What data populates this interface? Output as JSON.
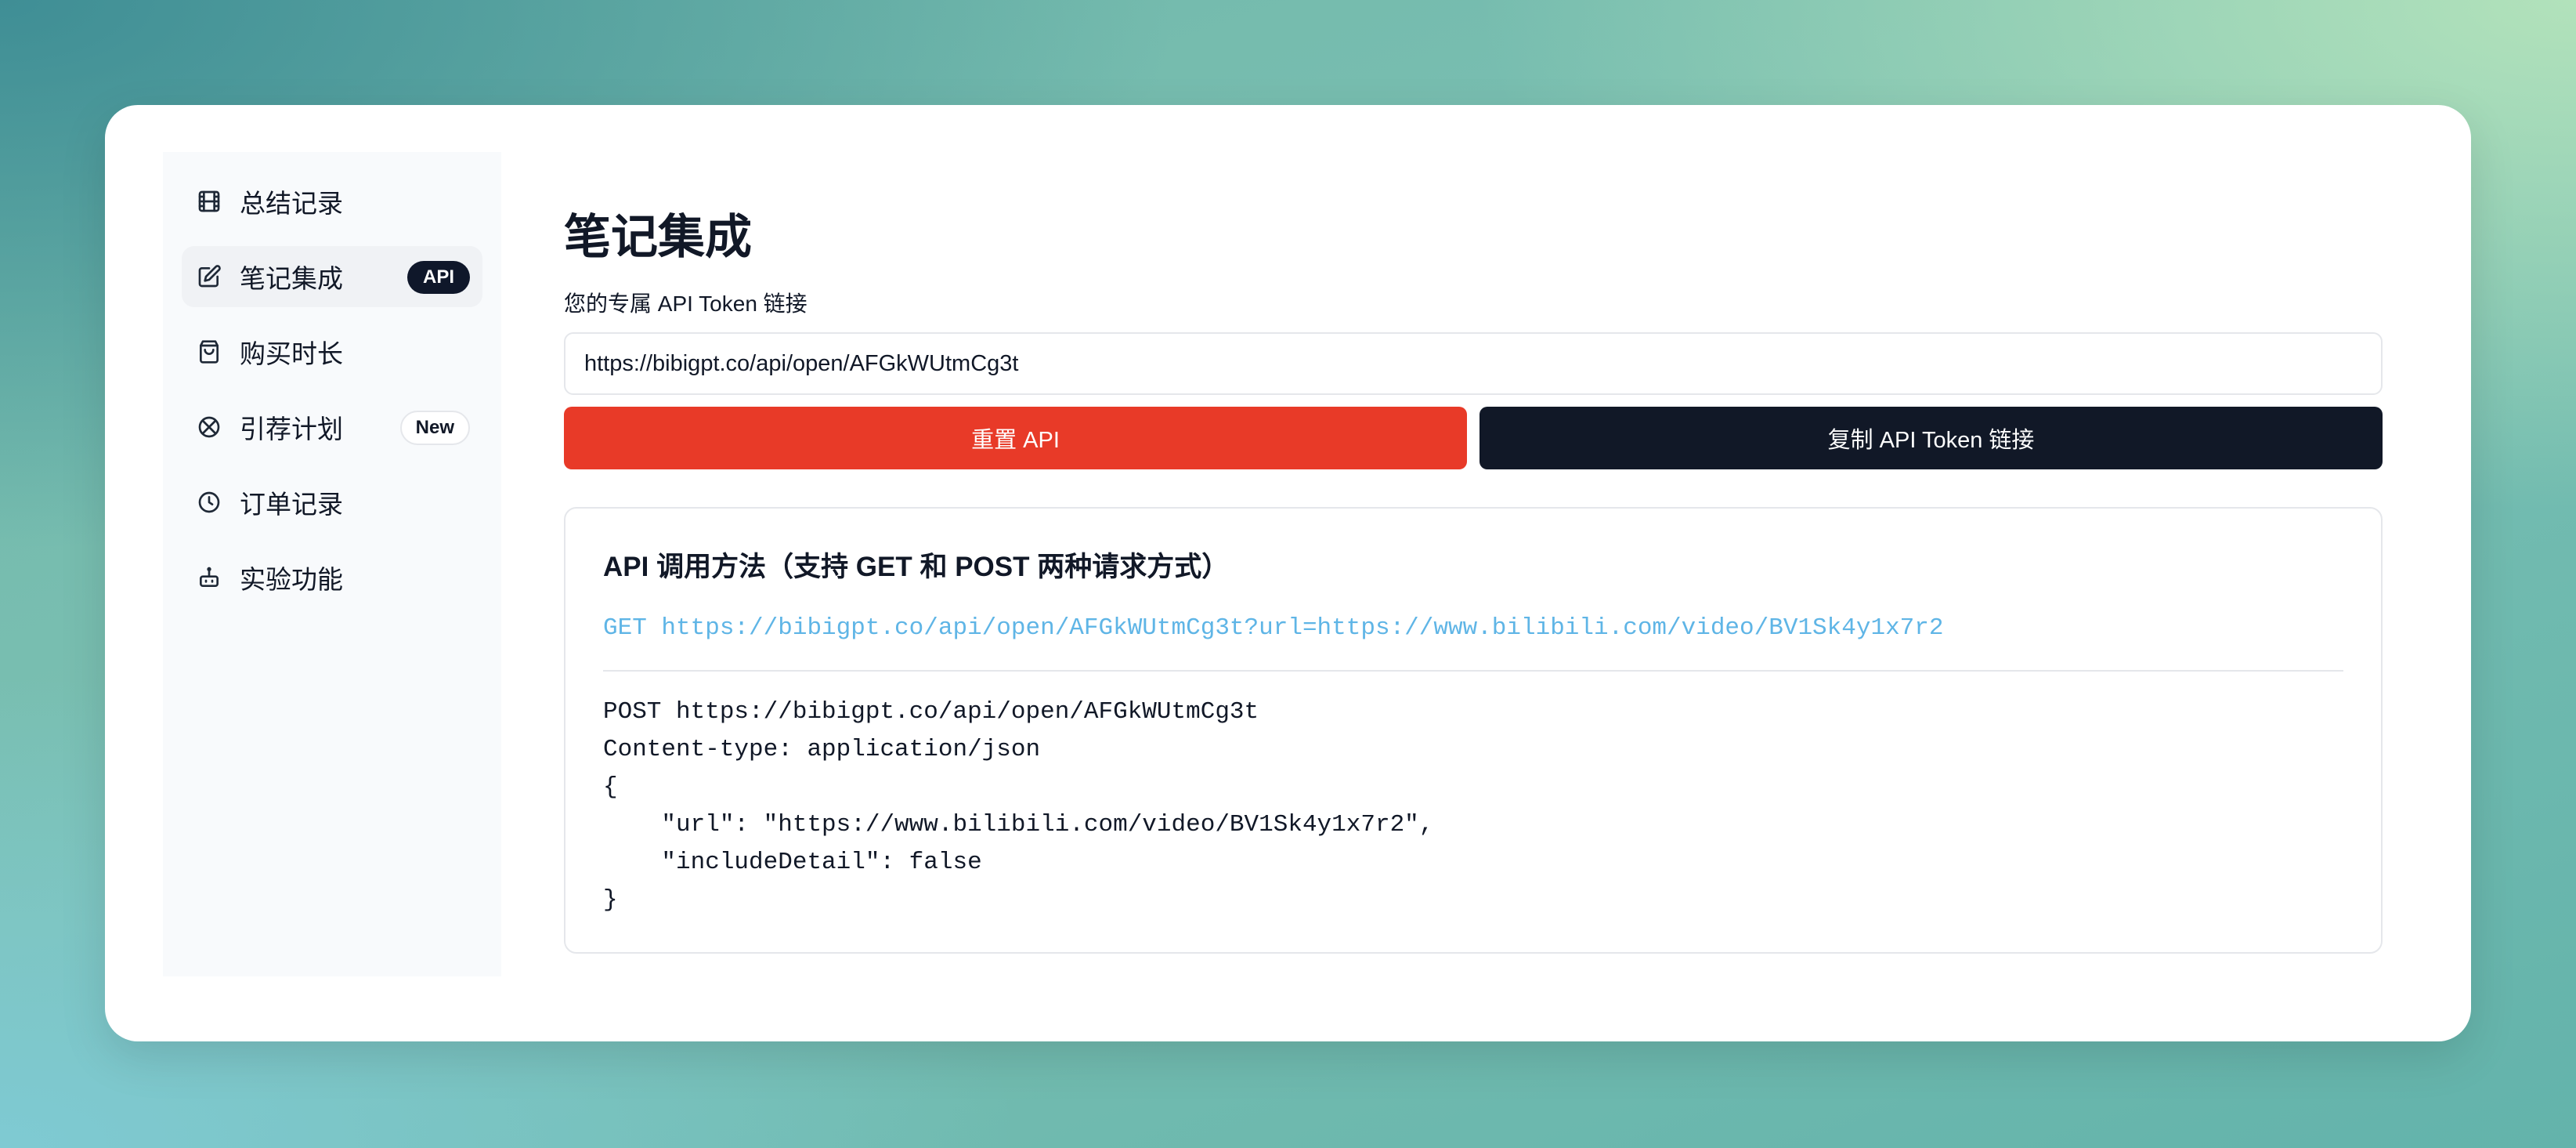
{
  "sidebar": {
    "items": [
      {
        "label": "总结记录",
        "icon": "film-icon"
      },
      {
        "label": "笔记集成",
        "icon": "edit-icon",
        "badge": "API",
        "active": true
      },
      {
        "label": "购买时长",
        "icon": "shopping-bag-icon"
      },
      {
        "label": "引荐计划",
        "icon": "referral-icon",
        "badge": "New"
      },
      {
        "label": "订单记录",
        "icon": "clock-icon"
      },
      {
        "label": "实验功能",
        "icon": "bot-icon"
      }
    ]
  },
  "main": {
    "title": "笔记集成",
    "token_label": "您的专属 API Token 链接",
    "token_value": "https://bibigpt.co/api/open/AFGkWUtmCg3t",
    "reset_button": "重置 API",
    "copy_button": "复制 API Token 链接",
    "usage": {
      "title": "API 调用方法（支持 GET 和 POST 两种请求方式）",
      "get_line": "GET https://bibigpt.co/api/open/AFGkWUtmCg3t?url=https://www.bilibili.com/video/BV1Sk4y1x7r2",
      "post_lines": [
        "POST https://bibigpt.co/api/open/AFGkWUtmCg3t",
        "Content-type: application/json",
        "{",
        "    \"url\": \"https://www.bilibili.com/video/BV1Sk4y1x7r2\",",
        "    \"includeDetail\": false",
        "}"
      ]
    }
  },
  "colors": {
    "accent_red": "#e83a28",
    "dark": "#111827",
    "link_blue": "#5fb5e6"
  }
}
